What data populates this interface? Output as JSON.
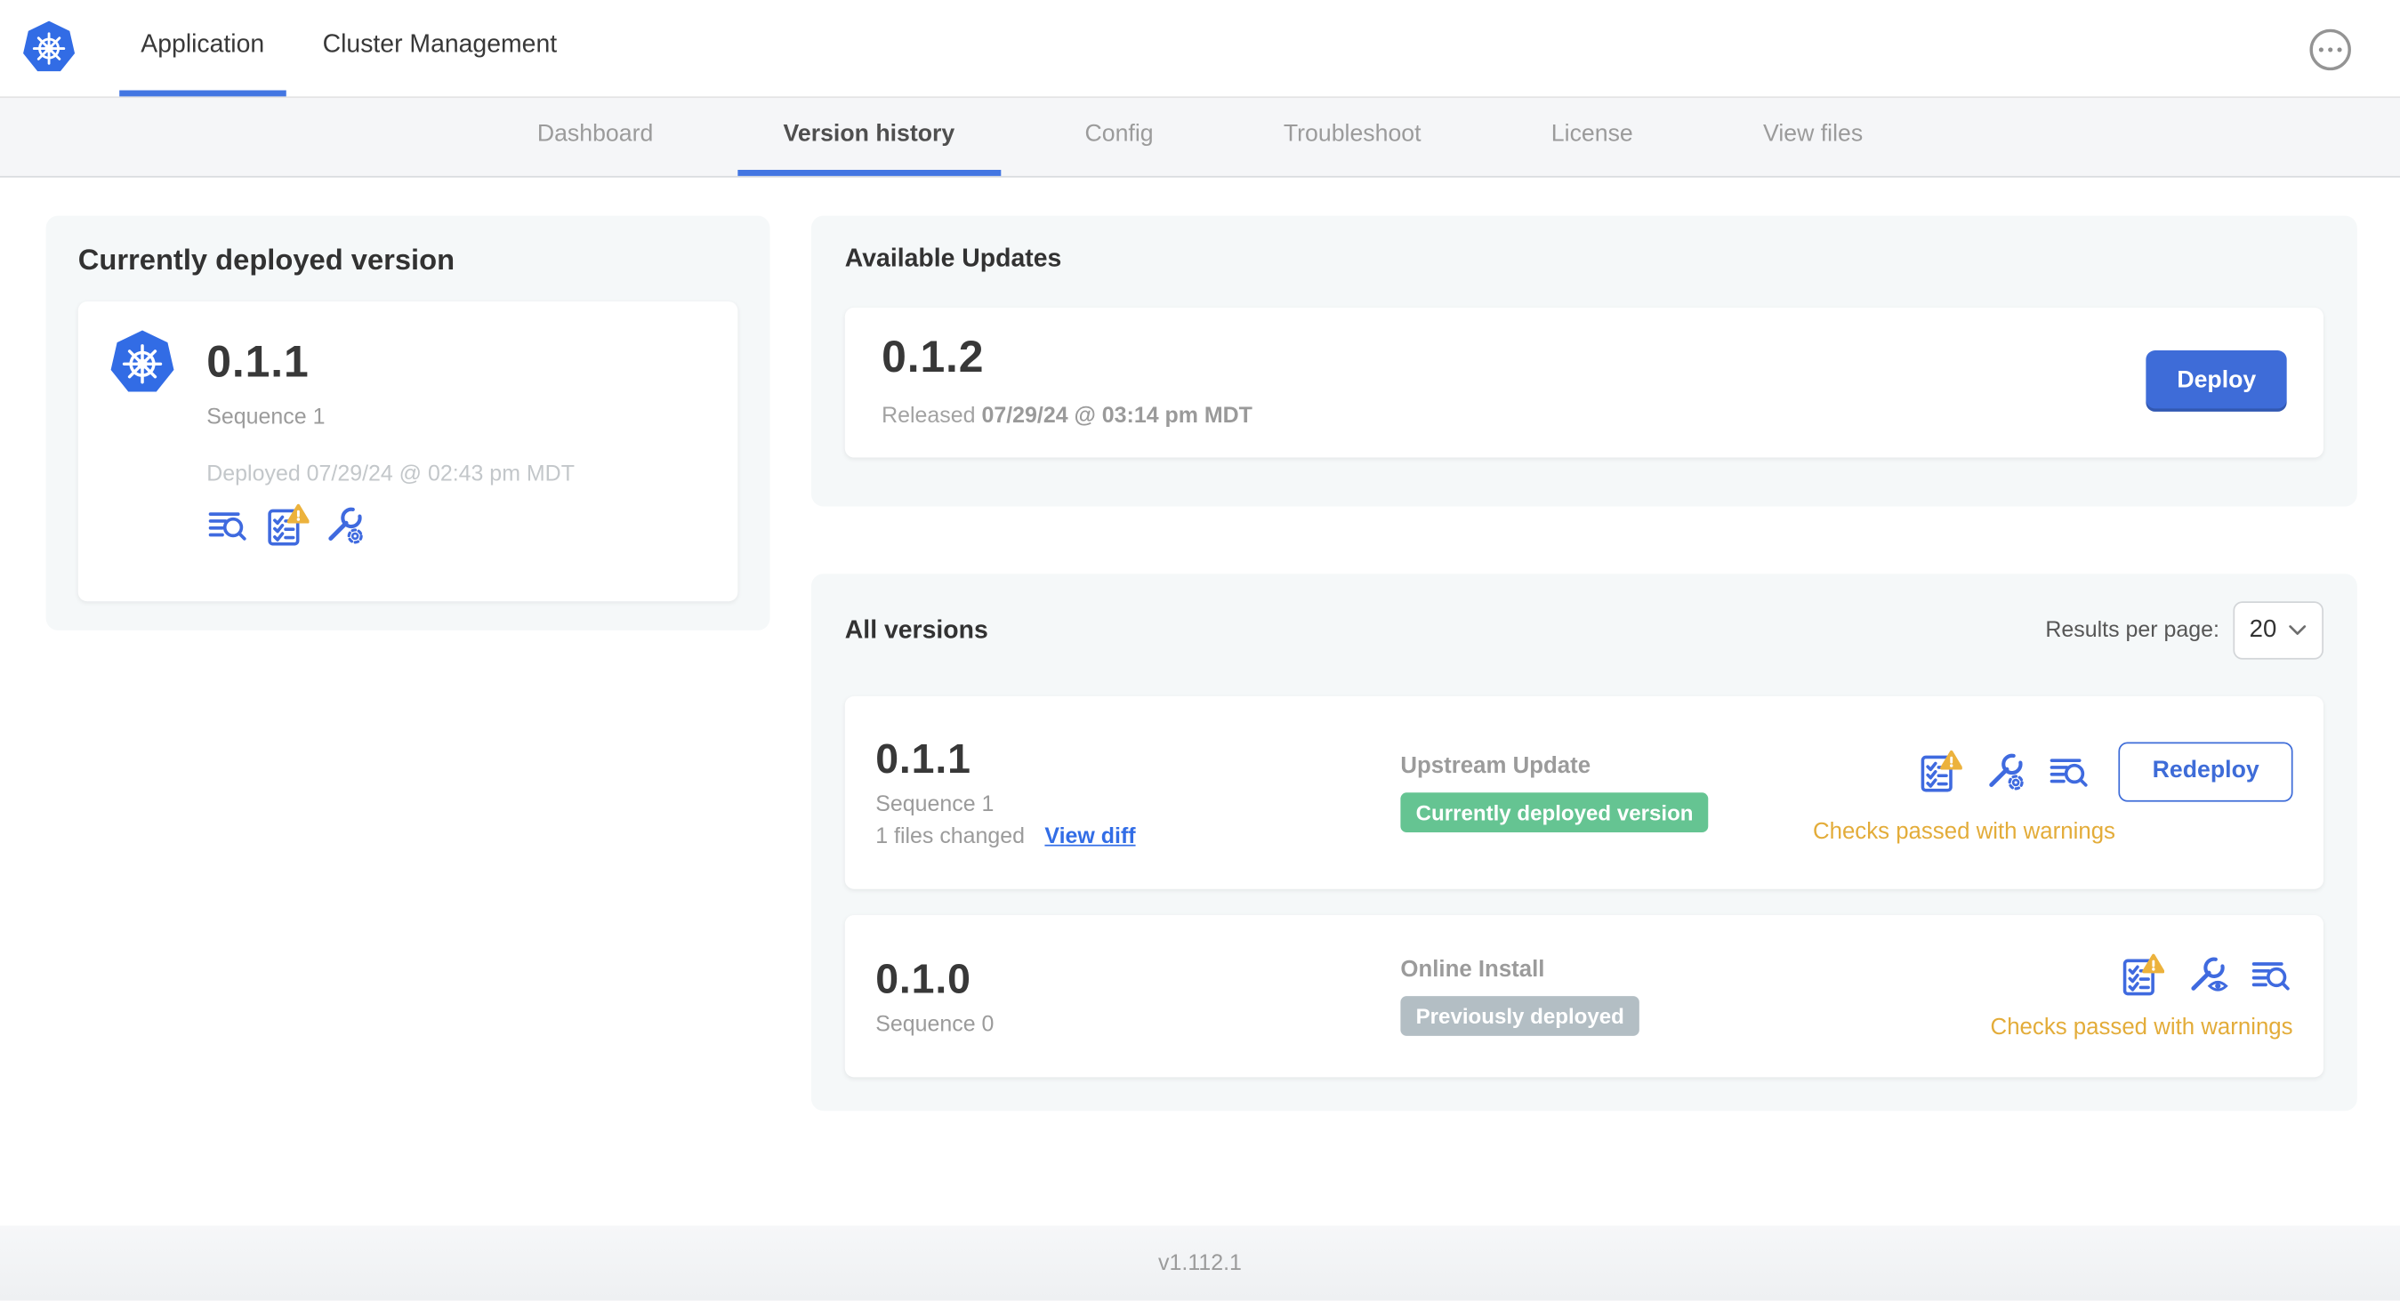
{
  "header": {
    "tabs": [
      {
        "label": "Application",
        "active": true
      },
      {
        "label": "Cluster Management",
        "active": false
      }
    ],
    "overflow_menu_icon": "ellipsis-icon",
    "logo_icon": "kubernetes-logo"
  },
  "subnav": {
    "tabs": [
      {
        "label": "Dashboard",
        "active": false
      },
      {
        "label": "Version history",
        "active": true
      },
      {
        "label": "Config",
        "active": false
      },
      {
        "label": "Troubleshoot",
        "active": false
      },
      {
        "label": "License",
        "active": false
      },
      {
        "label": "View files",
        "active": false
      }
    ]
  },
  "deployed_card": {
    "title": "Currently deployed version",
    "version": "0.1.1",
    "sequence": "Sequence 1",
    "deployed_at": "Deployed 07/29/24 @ 02:43 pm MDT",
    "icons": [
      "logs-icon",
      "preflight-warning-icon",
      "config-gear-icon"
    ],
    "app_icon": "kubernetes-logo"
  },
  "available_updates": {
    "title": "Available Updates",
    "version": "0.1.2",
    "released_label": "Released",
    "released_at": "07/29/24 @ 03:14 pm MDT",
    "deploy_label": "Deploy"
  },
  "all_versions": {
    "title": "All versions",
    "results_per_page_label": "Results per page:",
    "results_per_page_value": "20",
    "rows": [
      {
        "version": "0.1.1",
        "sequence": "Sequence 1",
        "files_changed": "1 files changed",
        "view_diff_label": "View diff",
        "source": "Upstream Update",
        "badge_label": "Currently deployed version",
        "badge_color": "#65c492",
        "icons": [
          "preflight-warning-icon",
          "config-gear-icon",
          "logs-icon"
        ],
        "action_label": "Redeploy",
        "status": "Checks passed with warnings"
      },
      {
        "version": "0.1.0",
        "sequence": "Sequence 0",
        "source": "Online Install",
        "badge_label": "Previously deployed",
        "badge_color": "#b3bec4",
        "icons": [
          "preflight-warning-icon",
          "config-view-icon",
          "logs-icon"
        ],
        "status": "Checks passed with warnings"
      }
    ]
  },
  "footer": {
    "version": "v1.112.1"
  },
  "colors": {
    "accent_blue": "#3e6cd8",
    "link_blue": "#326de6",
    "icon_blue": "#3f6adf",
    "kubernetes_blue": "#326ce5",
    "warning_amber": "#ecb23c",
    "badge_green": "#65c492",
    "badge_gray": "#b3bec4",
    "card_bg": "#f5f8f9",
    "subnav_bg": "#f5f6f8",
    "text_dark": "#323232",
    "text_gray": "#9b9b9b",
    "text_light_gray": "#c3c7ca"
  }
}
